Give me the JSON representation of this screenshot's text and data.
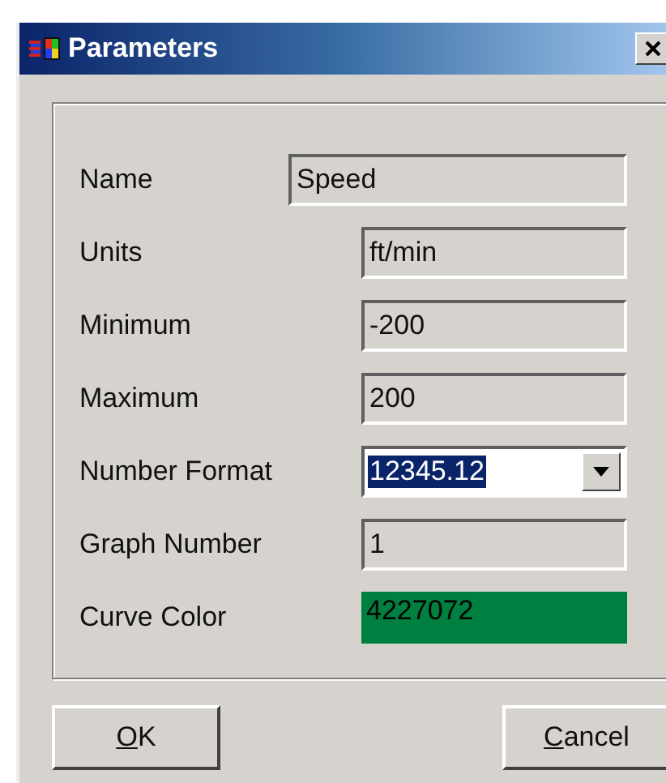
{
  "window": {
    "title": "Parameters"
  },
  "fields": [
    {
      "label": "Name",
      "value": "Speed",
      "kind": "text"
    },
    {
      "label": "Units",
      "value": "ft/min",
      "kind": "text"
    },
    {
      "label": "Minimum",
      "value": "-200",
      "kind": "text"
    },
    {
      "label": "Maximum",
      "value": "200",
      "kind": "text"
    },
    {
      "label": "Number Format",
      "value": "12345.12",
      "kind": "combo",
      "selected": true
    },
    {
      "label": "Graph Number",
      "value": "1",
      "kind": "text"
    },
    {
      "label": "Curve Color",
      "value": "4227072",
      "kind": "color",
      "color": "#008040"
    }
  ],
  "buttons": [
    "OK",
    "Cancel"
  ]
}
